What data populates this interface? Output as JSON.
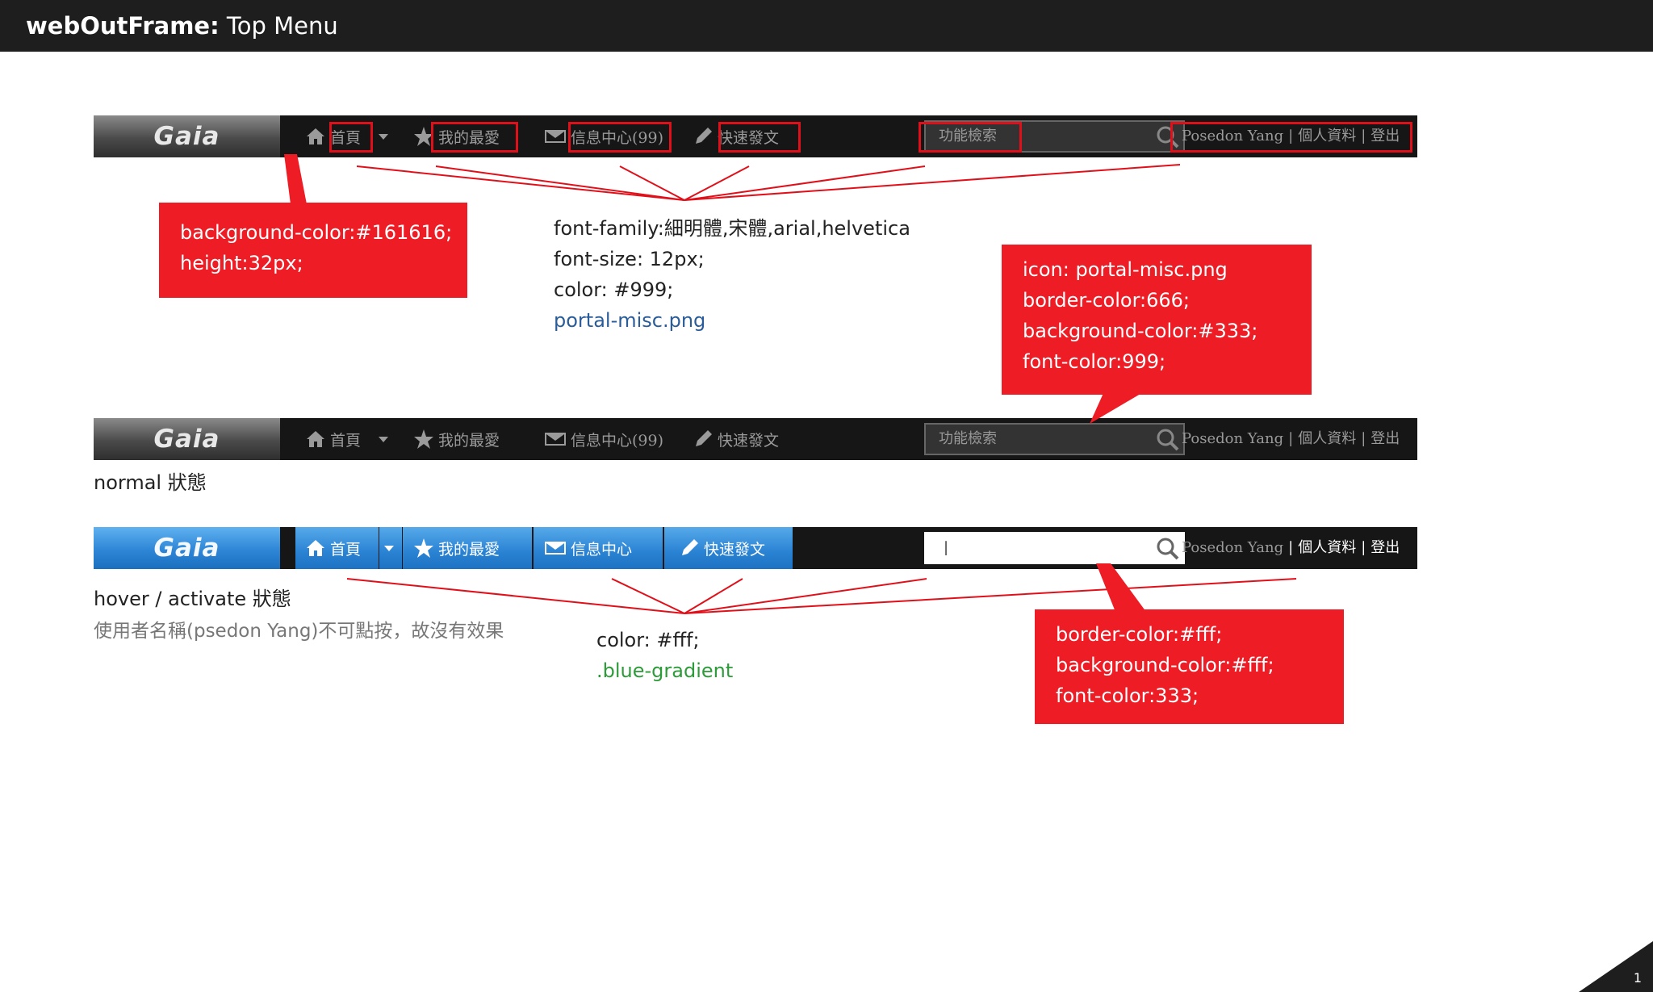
{
  "header": {
    "title_bold": "webOutFrame:",
    "title_rest": " Top Menu"
  },
  "menu": {
    "logo": "Gaia",
    "home": "首頁",
    "favorites": "我的最愛",
    "messages": "信息中心(99)",
    "messages_hover": "信息中心",
    "quickpost": "快速發文",
    "search_placeholder": "功能檢索",
    "search_hover_value": "|",
    "username": "Posedon Yang",
    "separator": "|",
    "profile": "個人資料",
    "logout": "登出"
  },
  "annotations": {
    "bar_spec": [
      "background-color:#161616;",
      "height:32px;"
    ],
    "font_spec": [
      "font-family:細明體,宋體,arial,helvetica",
      "font-size: 12px;",
      "color: #999;"
    ],
    "font_spec_link": "portal-misc.png",
    "search_spec": [
      "icon: portal-misc.png",
      "border-color:666;",
      "background-color:#333;",
      "font-color:999;"
    ],
    "normal_caption": "normal 狀態",
    "hover_caption": "hover / activate 狀態",
    "hover_note": "使用者名稱(psedon Yang)不可點按，故沒有效果",
    "hover_color_spec": "color: #fff;",
    "hover_class": ".blue-gradient",
    "hover_search_spec": [
      "border-color:#fff;",
      "background-color:#fff;",
      "font-color:333;"
    ]
  },
  "colors": {
    "bar_bg": "#161616",
    "callout_red": "#ee1c25",
    "hover_blue": "#2a82d3",
    "text_grey": "#999999"
  },
  "icons": [
    "home-icon",
    "dropdown-arrow-icon",
    "star-icon",
    "mail-icon",
    "pencil-icon",
    "magnifier-icon"
  ],
  "page_number": "1"
}
